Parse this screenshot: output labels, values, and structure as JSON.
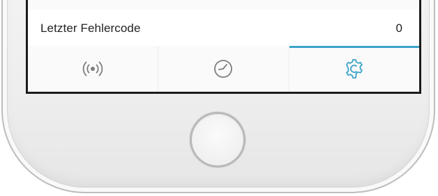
{
  "screen": {
    "row": {
      "label": "Letzter Fehlercode",
      "value": "0"
    },
    "tabs": [
      {
        "icon": "broadcast-icon",
        "active": false
      },
      {
        "icon": "clock-icon",
        "active": false
      },
      {
        "icon": "gear-icon",
        "active": true
      }
    ]
  },
  "colors": {
    "accent": "#3aa3c9",
    "icon_inactive": "#7d7d7d",
    "text": "#222222"
  }
}
